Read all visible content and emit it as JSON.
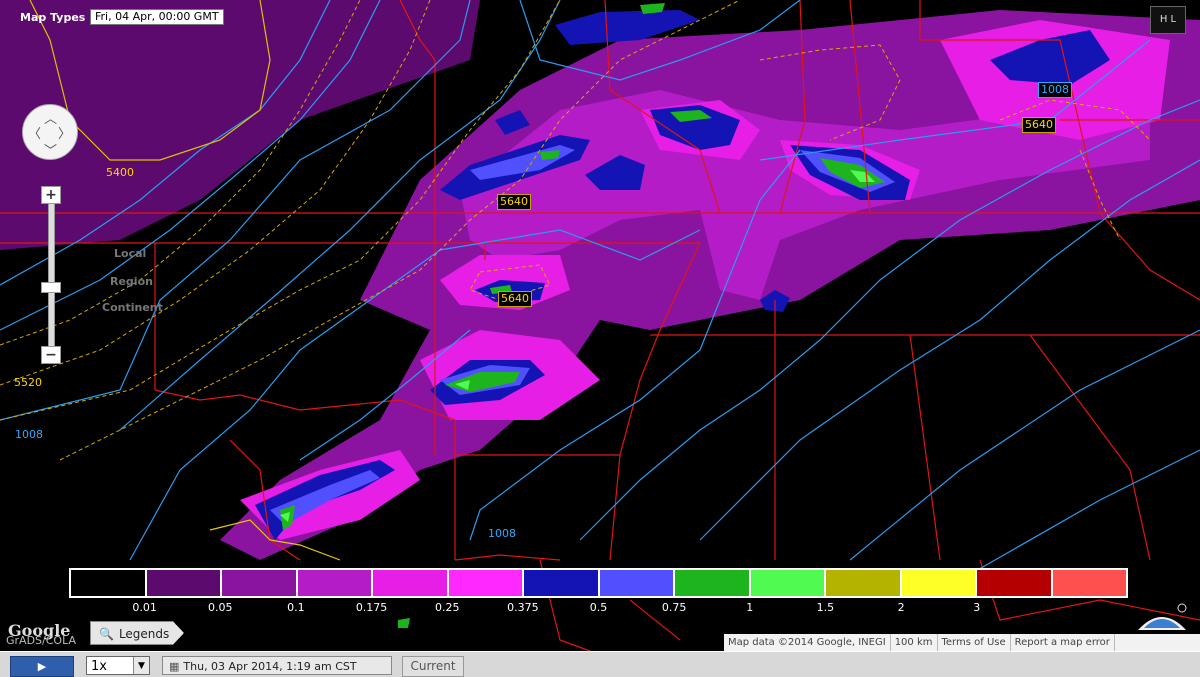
{
  "map": {
    "map_types_label": "Map Types",
    "valid_time": "Fri, 04 Apr, 00:00 GMT",
    "logo_text": "H L",
    "zoom_levels": [
      "Local",
      "Region",
      "Continent"
    ],
    "height_contour_labels": [
      "5400",
      "5640",
      "5640",
      "5640",
      "5520"
    ],
    "pressure_contour_labels": [
      "1008",
      "1008",
      "1008"
    ]
  },
  "legend": {
    "colors": [
      "#000000",
      "#5c0a6e",
      "#8a14a0",
      "#b41cc8",
      "#e61ee6",
      "#ff28ff",
      "#1414b4",
      "#5050ff",
      "#1eb41e",
      "#50fa50",
      "#b4b400",
      "#ffff28",
      "#b40000",
      "#ff5050"
    ],
    "values": [
      "0.01",
      "0.05",
      "0.1",
      "0.175",
      "0.25",
      "0.375",
      "0.5",
      "0.75",
      "1",
      "1.5",
      "2",
      "3"
    ],
    "button_label": "Legends"
  },
  "attribution": {
    "google": "Google",
    "grads": "GrADS/COLA",
    "map_data": "Map data ©2014 Google, INEGI",
    "scale": "100 km",
    "terms": "Terms of Use",
    "report": "Report a map error"
  },
  "controls": {
    "play_icon": "play-icon",
    "speed": "1x",
    "date": "Thu, 03 Apr 2014, 1:19 am CST",
    "current_label": "Current"
  }
}
